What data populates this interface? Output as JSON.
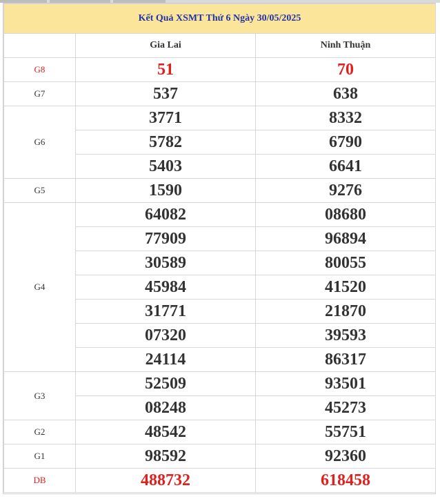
{
  "title": "Kết Quả XSMT Thứ 6 Ngày 30/05/2025",
  "provinces": [
    "Gia Lai",
    "Ninh Thuận"
  ],
  "prizes": {
    "g8": {
      "label": "G8",
      "gia_lai": [
        "51"
      ],
      "ninh_thuan": [
        "70"
      ]
    },
    "g7": {
      "label": "G7",
      "gia_lai": [
        "537"
      ],
      "ninh_thuan": [
        "638"
      ]
    },
    "g6": {
      "label": "G6",
      "gia_lai": [
        "3771",
        "5782",
        "5403"
      ],
      "ninh_thuan": [
        "8332",
        "6790",
        "6641"
      ]
    },
    "g5": {
      "label": "G5",
      "gia_lai": [
        "1590"
      ],
      "ninh_thuan": [
        "9276"
      ]
    },
    "g4": {
      "label": "G4",
      "gia_lai": [
        "64082",
        "77909",
        "30589",
        "45984",
        "31771",
        "07320",
        "24114"
      ],
      "ninh_thuan": [
        "08680",
        "96894",
        "80055",
        "41520",
        "21870",
        "39593",
        "86317"
      ]
    },
    "g3": {
      "label": "G3",
      "gia_lai": [
        "52509",
        "08248"
      ],
      "ninh_thuan": [
        "93501",
        "45273"
      ]
    },
    "g2": {
      "label": "G2",
      "gia_lai": [
        "48542"
      ],
      "ninh_thuan": [
        "55751"
      ]
    },
    "g1": {
      "label": "G1",
      "gia_lai": [
        "98592"
      ],
      "ninh_thuan": [
        "92360"
      ]
    },
    "db": {
      "label": "DB",
      "gia_lai": [
        "488732"
      ],
      "ninh_thuan": [
        "618458"
      ]
    }
  },
  "colors": {
    "title_bg": "#fbe59a",
    "title_text": "#2233a8",
    "highlight": "#e0201d",
    "text": "#333333"
  }
}
